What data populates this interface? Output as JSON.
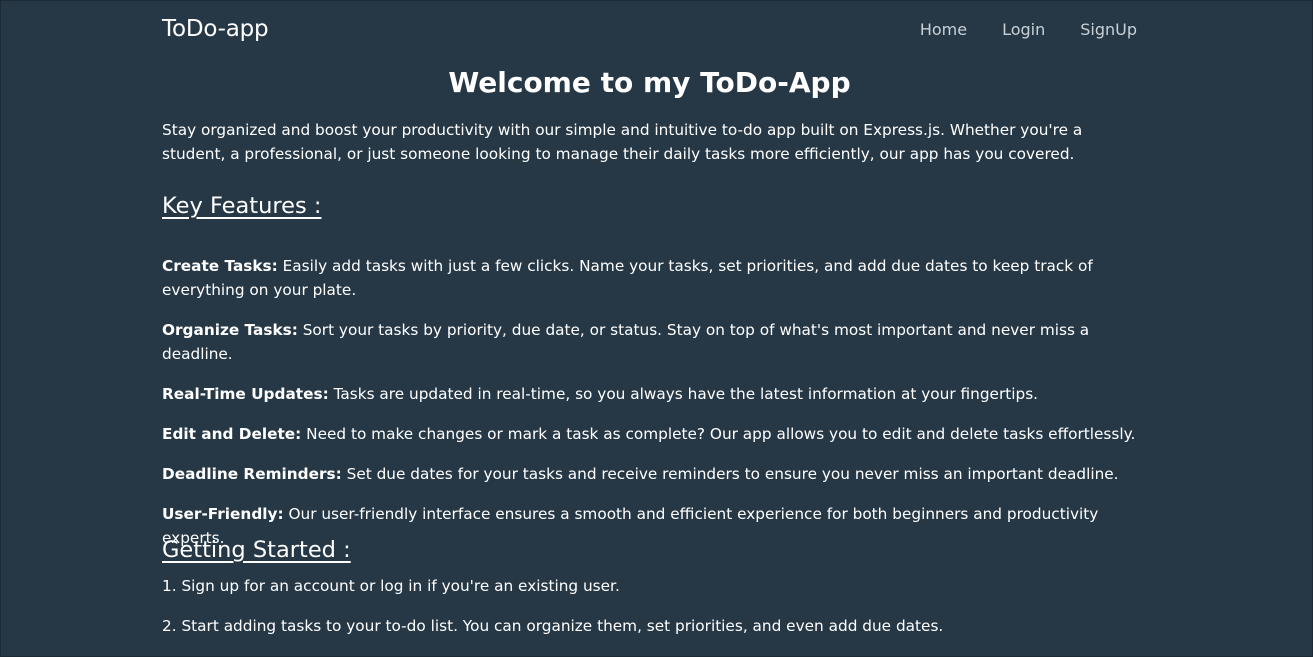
{
  "nav": {
    "brand": "ToDo-app",
    "links": [
      "Home",
      "Login",
      "SignUp"
    ]
  },
  "main": {
    "title": "Welcome to my ToDo-App",
    "intro": "Stay organized and boost your productivity with our simple and intuitive to-do app built on Express.js. Whether you're a student, a professional, or just someone looking to manage their daily tasks more efficiently, our app has you covered.",
    "features_heading": "Key Features :",
    "features": [
      {
        "name": "Create Tasks:",
        "text": " Easily add tasks with just a few clicks. Name your tasks, set priorities, and add due dates to keep track of everything on your plate."
      },
      {
        "name": "Organize Tasks:",
        "text": " Sort your tasks by priority, due date, or status. Stay on top of what's most important and never miss a deadline."
      },
      {
        "name": "Real-Time Updates:",
        "text": " Tasks are updated in real-time, so you always have the latest information at your fingertips."
      },
      {
        "name": "Edit and Delete:",
        "text": " Need to make changes or mark a task as complete? Our app allows you to edit and delete tasks effortlessly."
      },
      {
        "name": "Deadline Reminders:",
        "text": " Set due dates for your tasks and receive reminders to ensure you never miss an important deadline."
      },
      {
        "name": "User-Friendly:",
        "text": " Our user-friendly interface ensures a smooth and efficient experience for both beginners and productivity experts."
      }
    ],
    "getting_started_heading": "Getting Started :",
    "steps": [
      "1. Sign up for an account or log in if you're an existing user.",
      "2. Start adding tasks to your to-do list. You can organize them, set priorities, and even add due dates."
    ]
  }
}
